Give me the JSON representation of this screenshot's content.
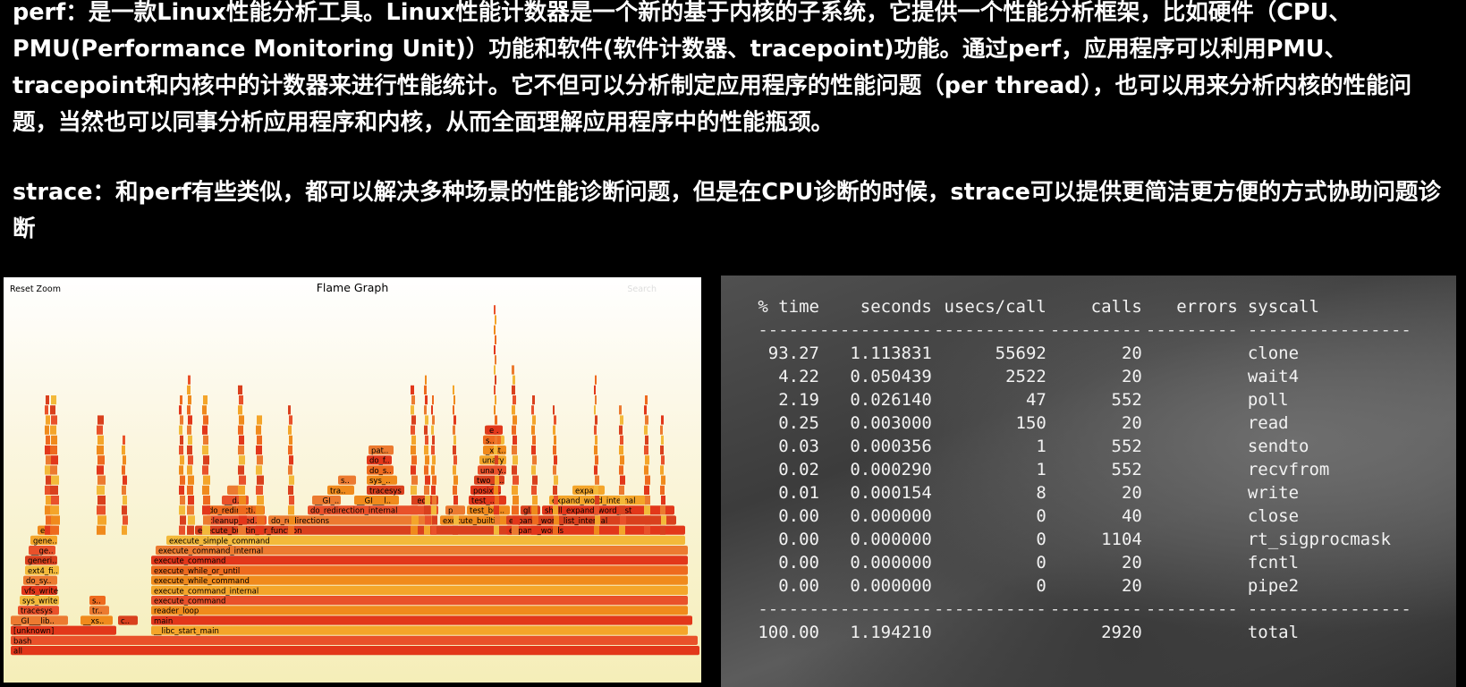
{
  "intro": {
    "perf_paragraph": "perf：是一款Linux性能分析工具。Linux性能计数器是一个新的基于内核的子系统，它提供一个性能分析框架，比如硬件（CPU、PMU(Performance Monitoring Unit)）功能和软件(软件计数器、tracepoint)功能。通过perf，应用程序可以利用PMU、tracepoint和内核中的计数器来进行性能统计。它不但可以分析制定应用程序的性能问题（per thread），也可以用来分析内核的性能问题，当然也可以同事分析应用程序和内核，从而全面理解应用程序中的性能瓶颈。",
    "strace_paragraph": "strace：和perf有些类似，都可以解决多种场景的性能诊断问题，但是在CPU诊断的时候，strace可以提供更简洁更方便的方式协助问题诊断"
  },
  "flame_graph": {
    "title": "Flame Graph",
    "reset_zoom": "Reset Zoom",
    "search_label": "Search",
    "colors": [
      "#e2371a",
      "#ee6a1e",
      "#f08a1c",
      "#f4a52a",
      "#e9512a",
      "#d9401d",
      "#f3b93a",
      "#ec7a30"
    ],
    "frames": [
      {
        "label": "all"
      },
      {
        "label": "bash"
      },
      {
        "label": "[unknown]"
      },
      {
        "label": "__libc_start_main"
      },
      {
        "label": "__GI___lib.."
      },
      {
        "label": "__xs.."
      },
      {
        "label": "c.."
      },
      {
        "label": "main"
      },
      {
        "label": "tracesys"
      },
      {
        "label": "tr.."
      },
      {
        "label": "reader_loop"
      },
      {
        "label": "sys_write"
      },
      {
        "label": "s.."
      },
      {
        "label": "execute_command"
      },
      {
        "label": "vfs_write"
      },
      {
        "label": "execute_command_internal"
      },
      {
        "label": "do_sy.."
      },
      {
        "label": "execute_while_command"
      },
      {
        "label": "ext4_fi.."
      },
      {
        "label": "execute_while_or_until"
      },
      {
        "label": "generi.."
      },
      {
        "label": "execute_command"
      },
      {
        "label": "__ge.."
      },
      {
        "label": "execute_command_internal"
      },
      {
        "label": "gene.."
      },
      {
        "label": "execute_simple_command"
      },
      {
        "label": "e.."
      },
      {
        "label": "execute_builtin_or_function"
      },
      {
        "label": "expand_words"
      },
      {
        "label": "cleanup_red.."
      },
      {
        "label": "do_redirections"
      },
      {
        "label": "execute_builtin"
      },
      {
        "label": "expand_word_list_internal"
      },
      {
        "label": "do_redirecti.."
      },
      {
        "label": "do_redirection_internal"
      },
      {
        "label": "p.."
      },
      {
        "label": "test_bui.."
      },
      {
        "label": "gl.."
      },
      {
        "label": "shell_expand_word_list"
      },
      {
        "label": "__d.."
      },
      {
        "label": "__GI_.."
      },
      {
        "label": "__GI___l.."
      },
      {
        "label": "red.."
      },
      {
        "label": "test_.."
      },
      {
        "label": "expand_word_internal"
      },
      {
        "label": "i.."
      },
      {
        "label": "tra.."
      },
      {
        "label": "tracesys"
      },
      {
        "label": "posixt.."
      },
      {
        "label": "expa.."
      },
      {
        "label": "s.."
      },
      {
        "label": "sys_.."
      },
      {
        "label": "two_a.."
      },
      {
        "label": "do_s.."
      },
      {
        "label": "unary.."
      },
      {
        "label": "do_f.."
      },
      {
        "label": "unary"
      },
      {
        "label": "pat.."
      },
      {
        "label": "_xst.."
      },
      {
        "label": "tra.."
      },
      {
        "label": "s.."
      },
      {
        "label": "S.."
      },
      {
        "label": "e.."
      }
    ]
  },
  "strace": {
    "headers": [
      "% time",
      "seconds",
      "usecs/call",
      "calls",
      "errors",
      "syscall"
    ],
    "separator": [
      "------",
      "-----------",
      "-----------",
      "---------",
      "---------",
      "----------------"
    ],
    "rows": [
      [
        "93.27",
        "1.113831",
        "55692",
        "20",
        "",
        "clone"
      ],
      [
        "4.22",
        "0.050439",
        "2522",
        "20",
        "",
        "wait4"
      ],
      [
        "2.19",
        "0.026140",
        "47",
        "552",
        "",
        "poll"
      ],
      [
        "0.25",
        "0.003000",
        "150",
        "20",
        "",
        "read"
      ],
      [
        "0.03",
        "0.000356",
        "1",
        "552",
        "",
        "sendto"
      ],
      [
        "0.02",
        "0.000290",
        "1",
        "552",
        "",
        "recvfrom"
      ],
      [
        "0.01",
        "0.000154",
        "8",
        "20",
        "",
        "write"
      ],
      [
        "0.00",
        "0.000000",
        "0",
        "40",
        "",
        "close"
      ],
      [
        "0.00",
        "0.000000",
        "0",
        "1104",
        "",
        "rt_sigprocmask"
      ],
      [
        "0.00",
        "0.000000",
        "0",
        "20",
        "",
        "fcntl"
      ],
      [
        "0.00",
        "0.000000",
        "0",
        "20",
        "",
        "pipe2"
      ]
    ],
    "total": [
      "100.00",
      "1.194210",
      "",
      "2920",
      "",
      "total"
    ]
  }
}
